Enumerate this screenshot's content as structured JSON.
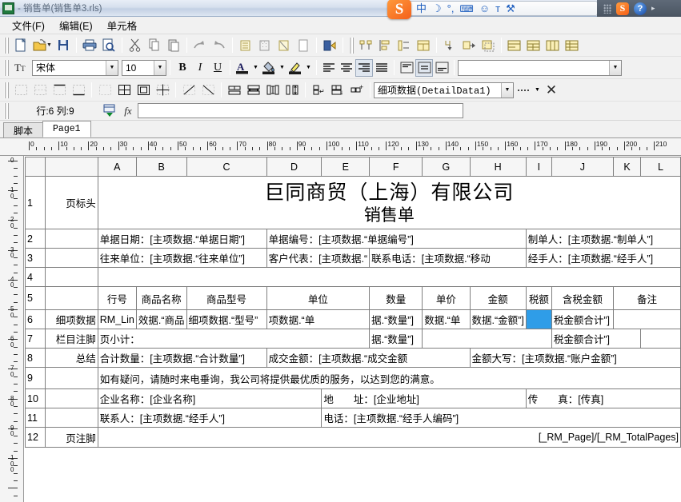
{
  "window": {
    "title": "- 销售单(销售单3.rls)",
    "app_icon": "report-designer-icon"
  },
  "ime": {
    "logo": "S",
    "items": [
      {
        "name": "chinese-mode-icon",
        "glyph": "中"
      },
      {
        "name": "moon-icon",
        "glyph": "☽"
      },
      {
        "name": "punctuation-icon",
        "glyph": "°,"
      },
      {
        "name": "keyboard-icon",
        "glyph": "⌨"
      },
      {
        "name": "user-icon",
        "glyph": "☺"
      },
      {
        "name": "skin-icon",
        "glyph": "т"
      },
      {
        "name": "toolbox-icon",
        "glyph": "⚒"
      }
    ]
  },
  "tray": {
    "sogou": "S",
    "help": "?",
    "arrow": "▸"
  },
  "menu": {
    "items": [
      {
        "name": "menu-file",
        "label": "文件(F)"
      },
      {
        "name": "menu-edit",
        "label": "编辑(E)"
      },
      {
        "name": "menu-cell",
        "label": "单元格"
      }
    ]
  },
  "toolbar_main": {
    "groups": [
      [
        "new-file",
        "open-file",
        "open-caret",
        "save-file"
      ],
      [
        "print",
        "print-preview"
      ],
      [
        "cut",
        "copy",
        "paste"
      ],
      [
        "redo",
        "undo"
      ],
      [
        "insert-row",
        "insert-pattern",
        "delete-row",
        "blank-page"
      ],
      [
        "exit-door"
      ],
      [
        "group-top",
        "align-left-obj",
        "distribute-obj",
        "table-head"
      ],
      [
        "merge-down",
        "shift-right",
        "select-area"
      ],
      [
        "band-1",
        "band-2",
        "band-3",
        "band-4"
      ]
    ]
  },
  "toolbar_font": {
    "font_name": "宋体",
    "font_size": "10",
    "bold": "B",
    "italic": "I",
    "underline": "U",
    "font_color": "A",
    "fill_color": "fill-bucket",
    "highlight_color": "highlight-pen",
    "align_left": "align-left",
    "align_center": "align-center",
    "align_right": "align-right",
    "align_justify": "align-justify",
    "valign_top": "valign-top",
    "valign_middle": "valign-middle",
    "valign_bottom": "valign-bottom",
    "style_value": ""
  },
  "toolbar_cell": {
    "band_name": "细项数据(DetailData1)",
    "border_style": "dotted-border",
    "close": "✕"
  },
  "formula": {
    "cell_ref": "行:6 列:9",
    "value": "",
    "fx": "fx",
    "picker": "cell-picker-icon"
  },
  "tabs": [
    {
      "name": "tab-script",
      "label": "脚本",
      "active": false
    },
    {
      "name": "tab-page1",
      "label": "Page1",
      "active": true
    }
  ],
  "ruler": {
    "h_labels": [
      "0",
      "10",
      "20",
      "30",
      "40",
      "50",
      "60",
      "70",
      "80",
      "90",
      "100",
      "110",
      "120",
      "130",
      "140",
      "150",
      "160",
      "170",
      "180",
      "190",
      "200",
      "210"
    ],
    "v_labels": [
      "0",
      "10",
      "20",
      "30",
      "40",
      "50",
      "60",
      "70",
      "80",
      "90",
      "100"
    ]
  },
  "sheet": {
    "columns": [
      "",
      "A",
      "B",
      "C",
      "D",
      "E",
      "F",
      "G",
      "H",
      "I",
      "J",
      "K",
      "L"
    ],
    "rows": [
      {
        "num": "1",
        "band": "页标头",
        "cells": [
          "巨同商贸（上海）有限公司",
          "销售单"
        ]
      },
      {
        "num": "2",
        "band": "",
        "cells": [
          "单据日期：[主项数据.“单据日期”]",
          "单据编号：[主项数据.“单据编号”]",
          "制单人：[主项数据.“制单人”]"
        ]
      },
      {
        "num": "3",
        "band": "",
        "cells": [
          "往来单位：[主项数据.“往来单位”]",
          "客户代表：[主项数据.“",
          "联系电话：[主项数据.“移动",
          "经手人：[主项数据.“经手人”]"
        ]
      },
      {
        "num": "4",
        "band": "",
        "cells": []
      },
      {
        "num": "5",
        "band": "",
        "cells": [
          "行号",
          "商品名称",
          "商品型号",
          "单位",
          "数量",
          "单价",
          "金额",
          "税额",
          "含税金额",
          "备注"
        ]
      },
      {
        "num": "6",
        "band": "细项数据",
        "cells": [
          "RM_Lin",
          "效据.“商品",
          "细项数据.“型号”",
          "项数据.“单",
          "据.“数量”]",
          "数据.“单",
          "数据.“金额”]",
          "",
          "税金额合计”]",
          ""
        ]
      },
      {
        "num": "7",
        "band": "栏目注脚",
        "cells": [
          "页小计：",
          "据.“数量”]",
          "税金额合计”]"
        ]
      },
      {
        "num": "8",
        "band": "总结",
        "cells": [
          "合计数量：[主项数据.“合计数量”]",
          "成交金额：[主项数据.“成交金额",
          "金额大写：[主项数据.“账户金额”]"
        ]
      },
      {
        "num": "9",
        "band": "",
        "cells": [
          "如有疑问，请随时来电垂询，我公司将提供最优质的服务，以达到您的满意。"
        ]
      },
      {
        "num": "10",
        "band": "",
        "cells": [
          "企业名称：[企业名称]",
          "地　　址：[企业地址]",
          "传　　真：[传真]"
        ]
      },
      {
        "num": "11",
        "band": "",
        "cells": [
          "联系人：[主项数据.“经手人”]",
          "电话：[主项数据.“经手人编码”]"
        ]
      },
      {
        "num": "12",
        "band": "页注脚",
        "cells": [
          "[_RM_Page]/[_RM_TotalPages]"
        ]
      }
    ]
  },
  "colors": {
    "selection": "#2f9de8",
    "titlebar_text": "#5b6a7d",
    "toolbar_bg": "#f1f1f1",
    "grid_line": "#7f7f7f"
  }
}
